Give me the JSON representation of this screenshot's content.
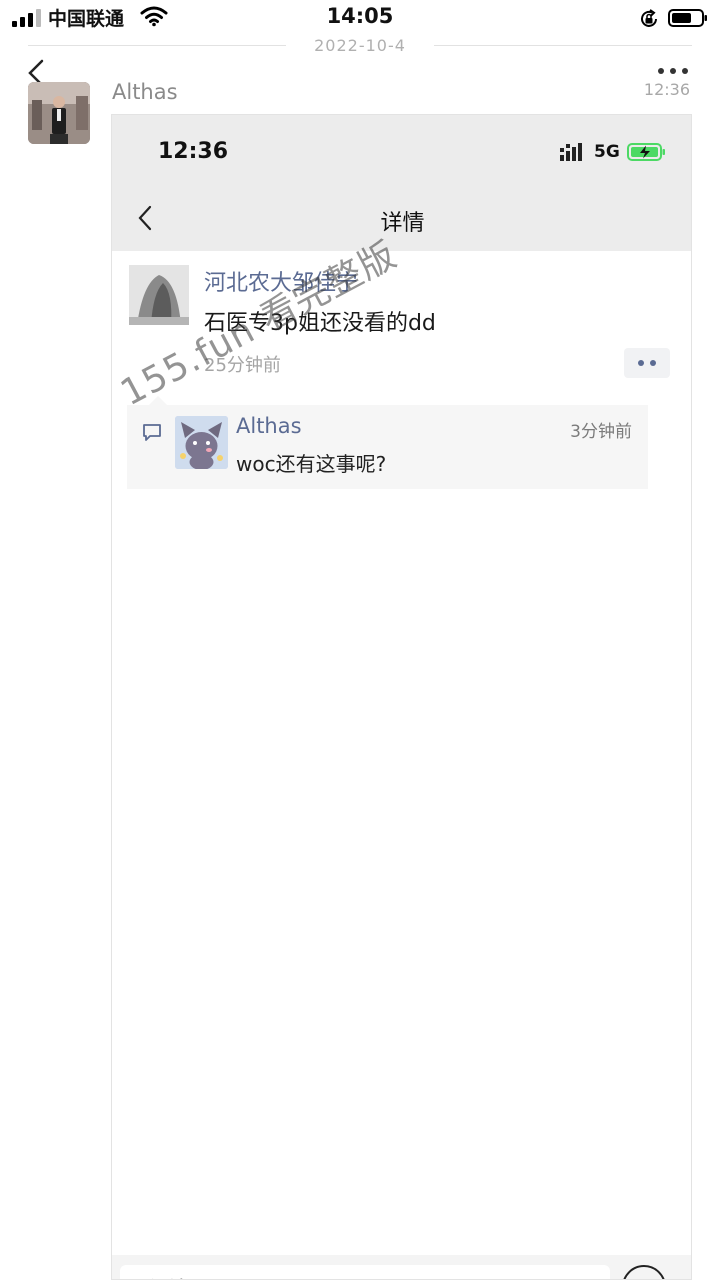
{
  "status_bar": {
    "carrier": "中国联通",
    "time": "14:05"
  },
  "chat": {
    "date": "2022-10-4",
    "sender_name": "Althas",
    "message_time": "12:36"
  },
  "screenshot": {
    "time": "12:36",
    "network": "5G",
    "title": "详情",
    "post": {
      "author": "河北农大邹佳宁",
      "body": "石医专3p姐还没看的dd",
      "time": "25分钟前"
    },
    "comment": {
      "author": "Althas",
      "time": "3分钟前",
      "text": "woc还有这事呢?"
    },
    "input_placeholder": "评论"
  },
  "watermark": "155.fun 看完整版",
  "colors": {
    "link_blue": "#5b6b93",
    "battery_green": "#4cd964",
    "header_gray": "#ececec"
  }
}
